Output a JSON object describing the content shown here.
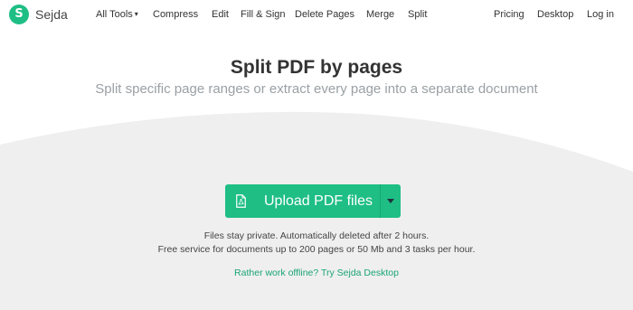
{
  "brand": {
    "name": "Sejda",
    "logo_letter": "S",
    "color": "#1ebe85"
  },
  "nav": {
    "all_tools": "All Tools",
    "compress": "Compress",
    "edit": "Edit",
    "fill_sign": "Fill & Sign",
    "delete_pages": "Delete Pages",
    "merge": "Merge",
    "split": "Split",
    "pricing": "Pricing",
    "desktop": "Desktop",
    "login": "Log in"
  },
  "hero": {
    "title": "Split PDF by pages",
    "subtitle": "Split specific page ranges or extract every page into a separate document"
  },
  "upload": {
    "label": "Upload PDF files",
    "icon": "pdf-file-icon"
  },
  "notes": {
    "privacy": "Files stay private. Automatically deleted after 2 hours.",
    "limits": "Free service for documents up to 200 pages or 50 Mb and 3 tasks per hour."
  },
  "offline_link": "Rather work offline? Try Sejda Desktop",
  "colors": {
    "accent": "#1ebe85",
    "link": "#1aa477",
    "band": "#efefef"
  }
}
